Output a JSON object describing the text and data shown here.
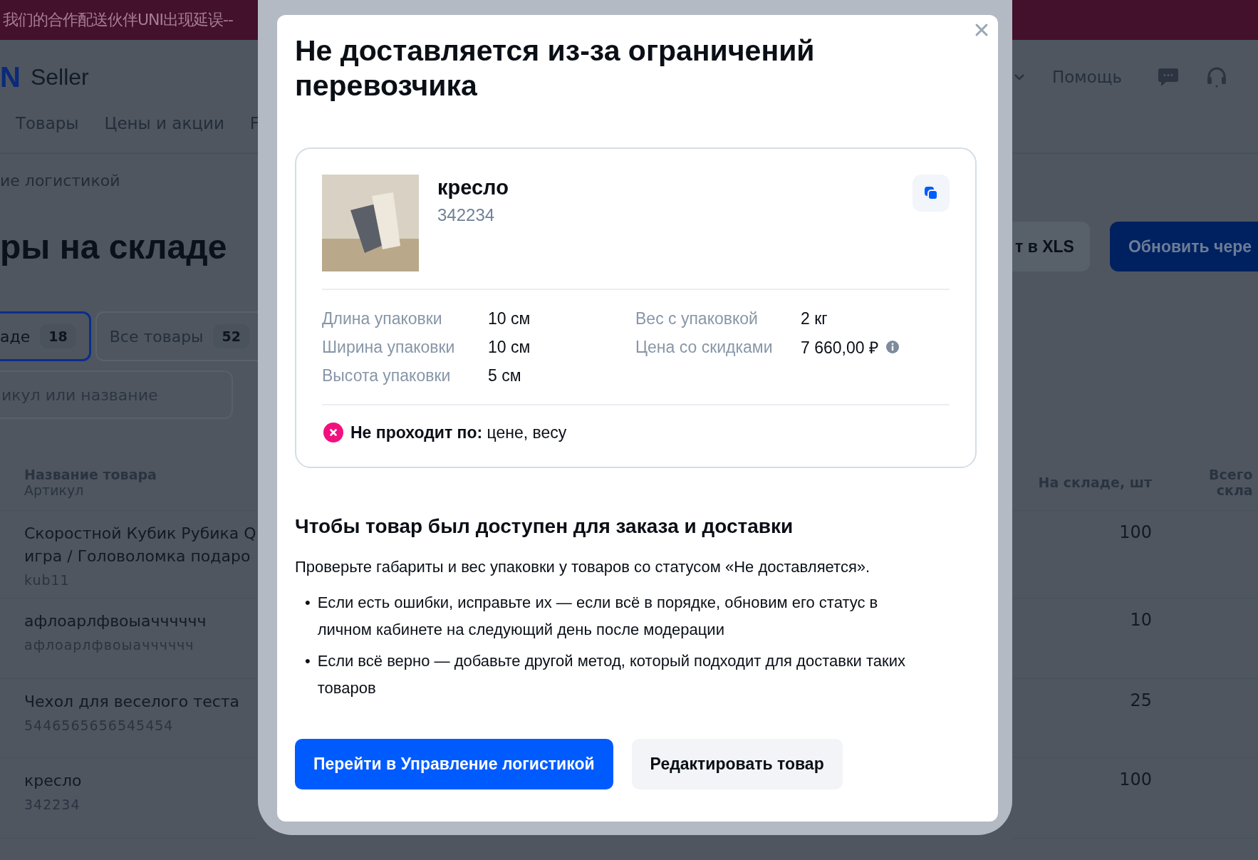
{
  "banner": {
    "text": "我们的合作配送伙伴UNI出现延误--"
  },
  "header": {
    "logo_fragment": "N",
    "logo_text": "Seller",
    "help": "Помощь"
  },
  "nav": [
    "Товары",
    "Цены и акции",
    "F"
  ],
  "breadcrumb": "ие логистикой",
  "page_title": "ры на складе",
  "toolbar_buttons": [
    {
      "label": "т в XLS",
      "kind": "secondary"
    },
    {
      "label": "Обновить чере",
      "kind": "primary"
    }
  ],
  "filter_tabs": [
    {
      "label": "аде",
      "count": "18",
      "selected": true
    },
    {
      "label": "Все товары",
      "count": "52",
      "selected": false
    }
  ],
  "search": {
    "placeholder": "икул или название"
  },
  "table": {
    "columns": [
      {
        "title": "Название товара",
        "subtitle": "Артикул"
      },
      {
        "title": "На складе, шт"
      },
      {
        "title": "Всего",
        "subtitle": "скла"
      }
    ],
    "rows": [
      {
        "name_lines": [
          "Скоростной Кубик Рубика Q",
          "игра / Головоломка подаро"
        ],
        "article": "kub11",
        "stock": "100"
      },
      {
        "name_lines": [
          "афлоарлфвоыачччччч"
        ],
        "article": "афлоарлфвоыачччччч",
        "stock": "10"
      },
      {
        "name_lines": [
          "Чехол для веселого теста"
        ],
        "article": "5446565656545454",
        "stock": "25"
      },
      {
        "name_lines": [
          "кресло"
        ],
        "article": "342234",
        "stock": "100"
      }
    ]
  },
  "modal": {
    "title": "Не доставляется из-за ограничений перевозчика",
    "product": {
      "name": "кресло",
      "article": "342234"
    },
    "specs": [
      {
        "label": "Длина упаковки",
        "value": "10 см"
      },
      {
        "label": "Ширина упаковки",
        "value": "10 см"
      },
      {
        "label": "Высота упаковки",
        "value": "5 см"
      }
    ],
    "specs_right": [
      {
        "label": "Вес с упаковкой",
        "value": "2 кг"
      },
      {
        "label": "Цена со скидками",
        "value": "7 660,00 ₽",
        "info": true
      }
    ],
    "failure": "**Не проходит по:** цене, весу",
    "section_title": "Чтобы товар был доступен для заказа и доставки",
    "paragraph": "Проверьте габариты и вес упаковки у товаров со статусом «Не доставляется».",
    "bullets": [
      {
        "marker": "•",
        "text": "Если есть ошибки, исправьте их — если всё в порядке, обновим его статус в личном кабинете на следующий день после модерации"
      },
      {
        "marker": "•",
        "text": "Если всё верно — добавьте другой метод, который подходит для доставки таких товаров"
      }
    ],
    "buttons": [
      {
        "label": "Перейти в Управление логистикой",
        "kind": "primary"
      },
      {
        "label": "Редактировать товар",
        "kind": "secondary"
      }
    ]
  }
}
